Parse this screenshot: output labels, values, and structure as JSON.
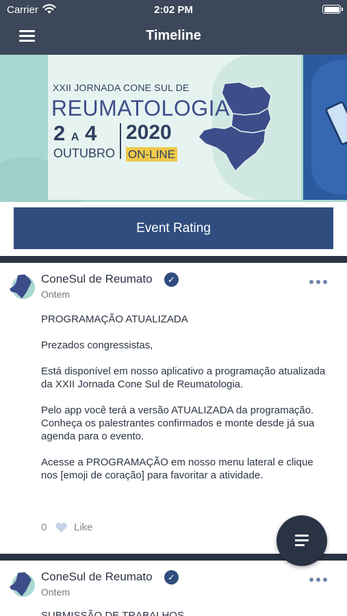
{
  "status_bar": {
    "carrier": "Carrier",
    "time": "2:02 PM"
  },
  "nav": {
    "title": "Timeline",
    "menu_icon": "hamburger-menu-icon"
  },
  "banner": {
    "line1": "XXII JORNADA CONE SUL DE",
    "line2": "REUMATOLOGIA",
    "day_start": "2",
    "day_sep": "A",
    "day_end": "4",
    "month": "OUTUBRO",
    "year": "2020",
    "mode": "ON-LINE"
  },
  "event_rating_button": "Event Rating",
  "posts": [
    {
      "author": "ConeSul de Reumato",
      "time": "Ontem",
      "paragraphs": [
        "PROGRAMAÇÃO ATUALIZADA",
        "Prezados congressistas,",
        "Está disponível em nosso aplicativo a programação atualizada da XXII Jornada Cone Sul de Reumatologia.",
        "Pelo app você terá a versão ATUALIZADA da programação. Conheça os palestrantes confirmados e monte desde já sua agenda para o evento.",
        "Acesse a PROGRAMAÇÃO em nosso menu lateral e clique nos [emoji de coração] para favoritar a atividade."
      ],
      "like_count": "0",
      "like_label": "Like"
    },
    {
      "author": "ConeSul de Reumato",
      "time": "Ontem",
      "paragraphs": [
        "SUBMISSÃO DE TRABALHOS"
      ]
    }
  ],
  "colors": {
    "nav_bg": "#3c4859",
    "button_bg": "#2f4d7e",
    "separator": "#2a3344",
    "banner_bg": "#a9d8d2",
    "online_tag": "#f0c94a"
  }
}
